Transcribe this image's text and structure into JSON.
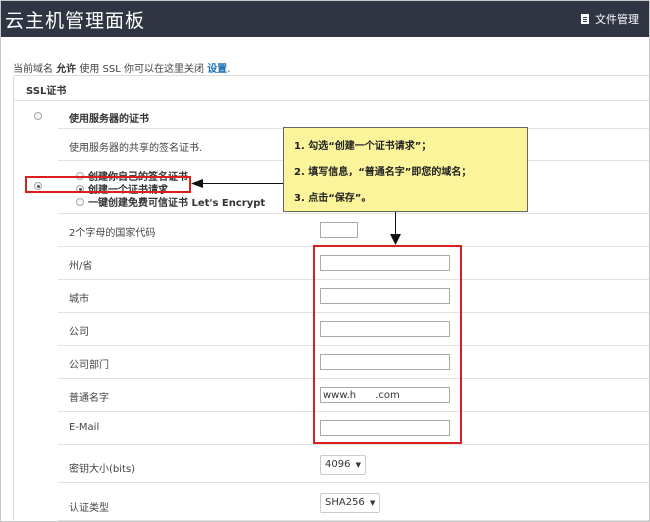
{
  "header": {
    "title": "云主机管理面板",
    "file_manager": "文件管理",
    "file_icon": "document-icon"
  },
  "notice": {
    "prefix": "当前域名",
    "allow": "允许",
    "middle": "使用 SSL 你可以在这里关闭",
    "link": "设置",
    "suffix": "."
  },
  "ssl": {
    "section_title": "SSL证书",
    "server_option": "使用服务器的证书",
    "server_desc": "使用服务器的共享的签名证书.",
    "options": [
      "创建你自己的签名证书",
      "创建一个证书请求",
      "一键创建免费可信证书 Let's Encrypt"
    ],
    "selected_option": 1
  },
  "form": {
    "country_label": "2个字母的国家代码",
    "fields": [
      {
        "label": "州/省",
        "value": ""
      },
      {
        "label": "城市",
        "value": ""
      },
      {
        "label": "公司",
        "value": ""
      },
      {
        "label": "公司部门",
        "value": ""
      },
      {
        "label": "普通名字",
        "value": "www.h      .com"
      },
      {
        "label": "E-Mail",
        "value": ""
      }
    ],
    "key_size_label": "密钥大小(bits)",
    "key_size_value": "4096",
    "sig_type_label": "认证类型",
    "sig_type_value": "SHA256"
  },
  "callout": {
    "step1": "1. 勾选“创建一个证书请求”；",
    "step2": "2. 填写信息，“普通名字”即您的域名；",
    "step3": "3. 点击“保存”。"
  },
  "colors": {
    "header_bg": "#2f3542",
    "link": "#1a6fb5",
    "highlight": "#d9201f",
    "callout_bg": "#fbf49a"
  }
}
